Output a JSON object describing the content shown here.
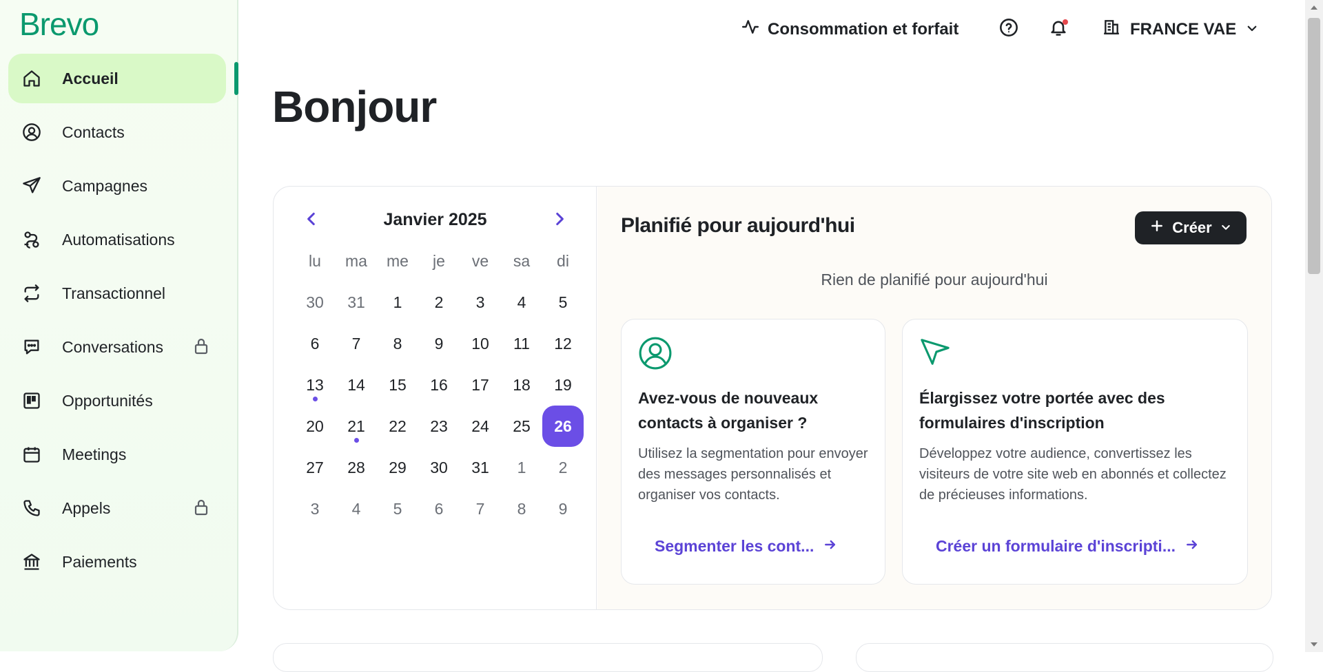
{
  "app": {
    "logo": "Brevo"
  },
  "sidebar": {
    "items": [
      {
        "label": "Accueil",
        "icon": "home-icon",
        "active": true
      },
      {
        "label": "Contacts",
        "icon": "user-circle-icon"
      },
      {
        "label": "Campagnes",
        "icon": "send-icon"
      },
      {
        "label": "Automatisations",
        "icon": "automation-icon"
      },
      {
        "label": "Transactionnel",
        "icon": "repeat-icon"
      },
      {
        "label": "Conversations",
        "icon": "chat-icon",
        "locked": true
      },
      {
        "label": "Opportunités",
        "icon": "kanban-icon"
      },
      {
        "label": "Meetings",
        "icon": "calendar-icon"
      },
      {
        "label": "Appels",
        "icon": "phone-icon",
        "locked": true
      },
      {
        "label": "Paiements",
        "icon": "bank-icon"
      }
    ]
  },
  "topbar": {
    "usage_label": "Consommation et forfait",
    "account_name": "FRANCE VAE"
  },
  "main": {
    "greeting": "Bonjour"
  },
  "calendar": {
    "title": "Janvier 2025",
    "weekdays": [
      "lu",
      "ma",
      "me",
      "je",
      "ve",
      "sa",
      "di"
    ],
    "weeks": [
      [
        {
          "d": "30",
          "m": true
        },
        {
          "d": "31",
          "m": true
        },
        {
          "d": "1"
        },
        {
          "d": "2"
        },
        {
          "d": "3"
        },
        {
          "d": "4"
        },
        {
          "d": "5"
        }
      ],
      [
        {
          "d": "6"
        },
        {
          "d": "7"
        },
        {
          "d": "8"
        },
        {
          "d": "9"
        },
        {
          "d": "10"
        },
        {
          "d": "11"
        },
        {
          "d": "12"
        }
      ],
      [
        {
          "d": "13",
          "dot": true
        },
        {
          "d": "14"
        },
        {
          "d": "15"
        },
        {
          "d": "16"
        },
        {
          "d": "17"
        },
        {
          "d": "18"
        },
        {
          "d": "19"
        }
      ],
      [
        {
          "d": "20"
        },
        {
          "d": "21",
          "dot": true
        },
        {
          "d": "22"
        },
        {
          "d": "23"
        },
        {
          "d": "24"
        },
        {
          "d": "25"
        },
        {
          "d": "26",
          "today": true
        }
      ],
      [
        {
          "d": "27"
        },
        {
          "d": "28"
        },
        {
          "d": "29"
        },
        {
          "d": "30"
        },
        {
          "d": "31"
        },
        {
          "d": "1",
          "m": true
        },
        {
          "d": "2",
          "m": true
        }
      ],
      [
        {
          "d": "3",
          "m": true
        },
        {
          "d": "4",
          "m": true
        },
        {
          "d": "5",
          "m": true
        },
        {
          "d": "6",
          "m": true
        },
        {
          "d": "7",
          "m": true
        },
        {
          "d": "8",
          "m": true
        },
        {
          "d": "9",
          "m": true
        }
      ]
    ]
  },
  "planned": {
    "title": "Planifié pour aujourd'hui",
    "create_label": "Créer",
    "empty_text": "Rien de planifié pour aujourd'hui"
  },
  "cards": {
    "contacts": {
      "title": "Avez-vous de nouveaux contacts à organiser ?",
      "description": "Utilisez la segmentation pour envoyer des messages personnalisés et organiser vos contacts.",
      "link": "Segmenter les cont..."
    },
    "forms": {
      "title": "Élargissez votre portée avec des formulaires d'inscription",
      "description": "Développez votre audience, convertissez les visiteurs de votre site web en abonnés et collectez de précieuses informations.",
      "link": "Créer un formulaire d'inscripti..."
    }
  },
  "colors": {
    "brand": "#0b996e",
    "accent": "#6b4ee6",
    "link": "#5b43d6",
    "active_nav_bg": "#d9f9c7"
  }
}
